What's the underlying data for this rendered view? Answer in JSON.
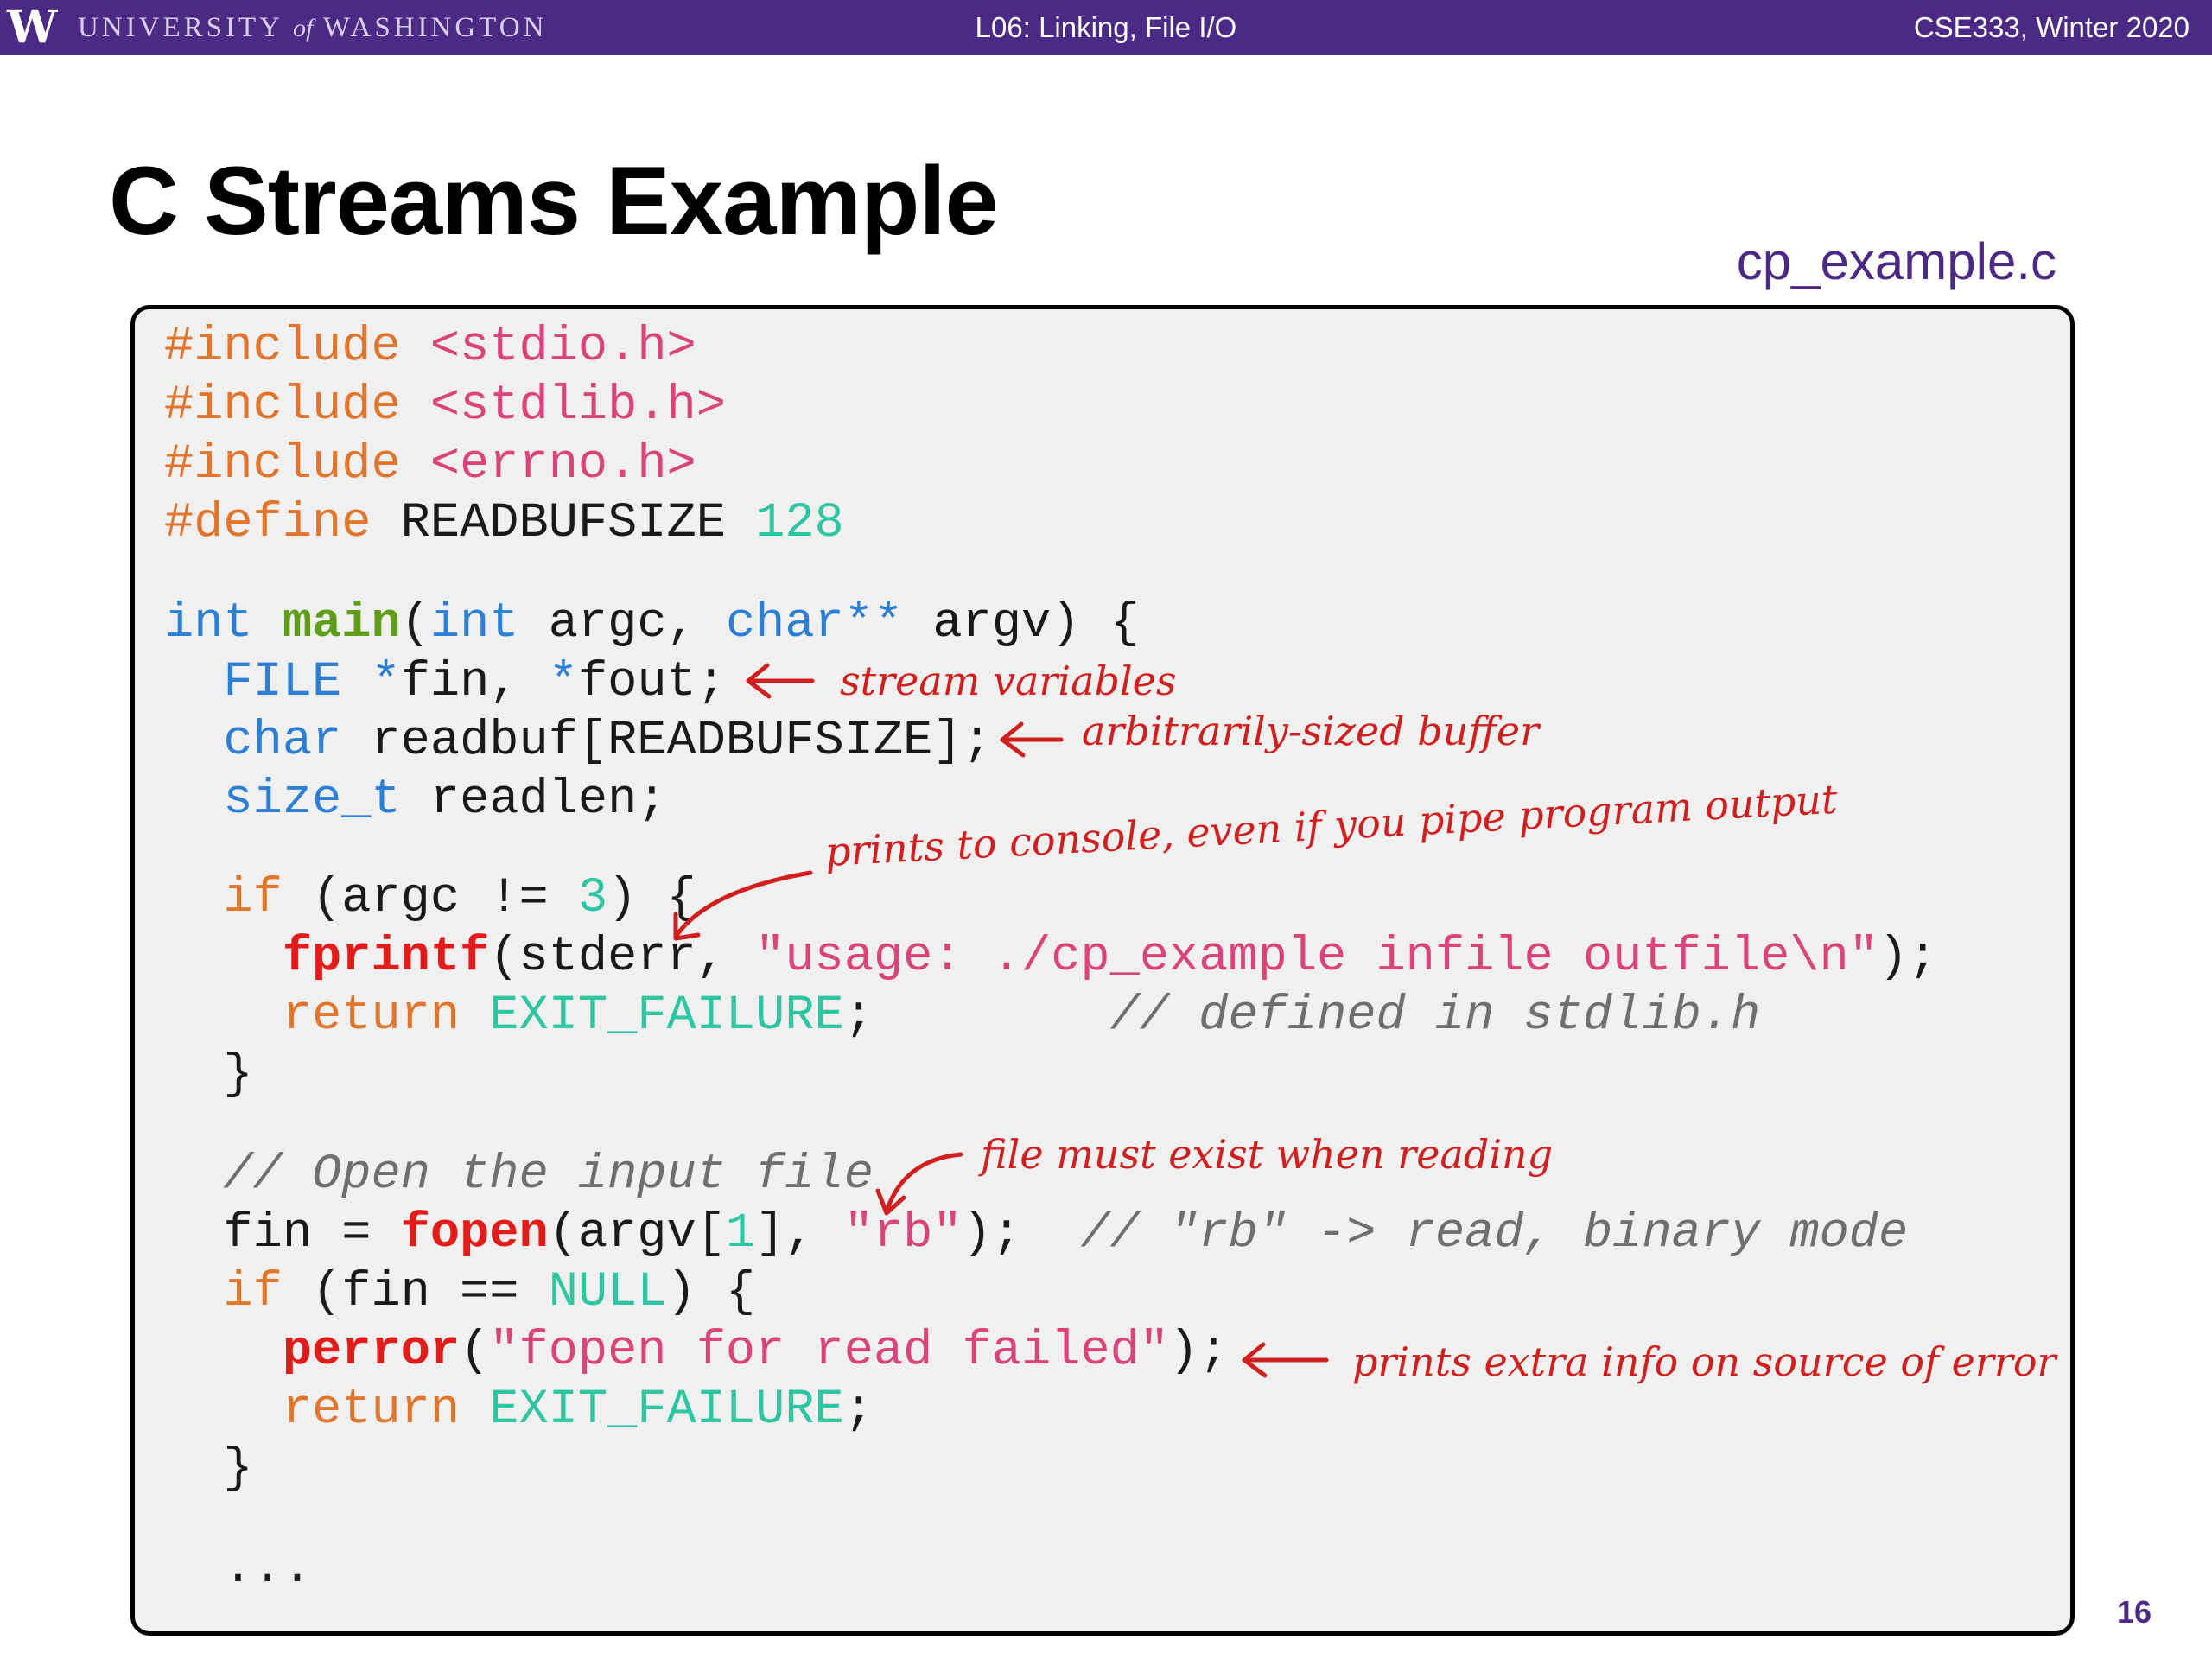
{
  "header": {
    "logo_letter": "W",
    "university_pre": "UNIVERSITY",
    "university_of": "of",
    "university_post": "WASHINGTON",
    "lecture": "L06:  Linking, File I/O",
    "course": "CSE333, Winter 2020"
  },
  "slide": {
    "title": "C Streams Example",
    "filename": "cp_example.c",
    "page_number": "16"
  },
  "code": {
    "l1_dir": "#include",
    "l1_hdr": "<stdio.h>",
    "l2_dir": "#include",
    "l2_hdr": "<stdlib.h>",
    "l3_dir": "#include",
    "l3_hdr": "<errno.h>",
    "l4_dir": "#define",
    "l4_name": " READBUFSIZE ",
    "l4_val": "128",
    "l5_int": "int",
    "l5_main": "main",
    "l5_p1": "(",
    "l5_int2": "int",
    "l5_p2": " argc, ",
    "l5_char": "char**",
    "l5_p3": " argv) {",
    "l6_file": "FILE",
    "l6_star1": "*",
    "l6_fin": "fin, ",
    "l6_star2": "*",
    "l6_fout": "fout;",
    "l7_char": "char",
    "l7_rest": " readbuf[READBUFSIZE];",
    "l8_size": "size_t",
    "l8_rest": " readlen;",
    "l9_if": "if",
    "l9_p1": " (argc != ",
    "l9_num": "3",
    "l9_p2": ") {",
    "l10_fn": "fprintf",
    "l10_p1": "(stderr, ",
    "l10_str": "\"usage: ./cp_example infile outfile\\n\"",
    "l10_p2": ");",
    "l11_ret": "return",
    "l11_const": "EXIT_FAILURE",
    "l11_semi": ";",
    "l11_cmt": "// defined in stdlib.h",
    "l12_brace": "}",
    "l13_cmt": "// Open the input file",
    "l14_fin": "fin = ",
    "l14_fn": "fopen",
    "l14_p1": "(argv[",
    "l14_num": "1",
    "l14_p2": "], ",
    "l14_str": "\"rb\"",
    "l14_p3": ");",
    "l14_cmt": "// \"rb\" -> read, binary mode",
    "l15_if": "if",
    "l15_p1": " (fin == ",
    "l15_null": "NULL",
    "l15_p2": ") {",
    "l16_fn": "perror",
    "l16_p1": "(",
    "l16_str": "\"fopen for read failed\"",
    "l16_p2": ");",
    "l17_ret": "return",
    "l17_const": "EXIT_FAILURE",
    "l17_semi": ";",
    "l18_brace": "}",
    "l19_dots": "..."
  },
  "annotations": {
    "stream_vars": "stream variables",
    "buffer": "arbitrarily-sized buffer",
    "console": "prints to console, even if you pipe program output",
    "file_exist": "file must exist when reading",
    "perror_info": "prints extra info on source of error"
  },
  "colors": {
    "uw_purple": "#4b2a85",
    "annotation_red": "#cf1f1f",
    "keyword_blue": "#2c7fd4",
    "preproc_orange": "#e0752b",
    "string_pink": "#d9457b",
    "number_teal": "#2ec6a0"
  }
}
